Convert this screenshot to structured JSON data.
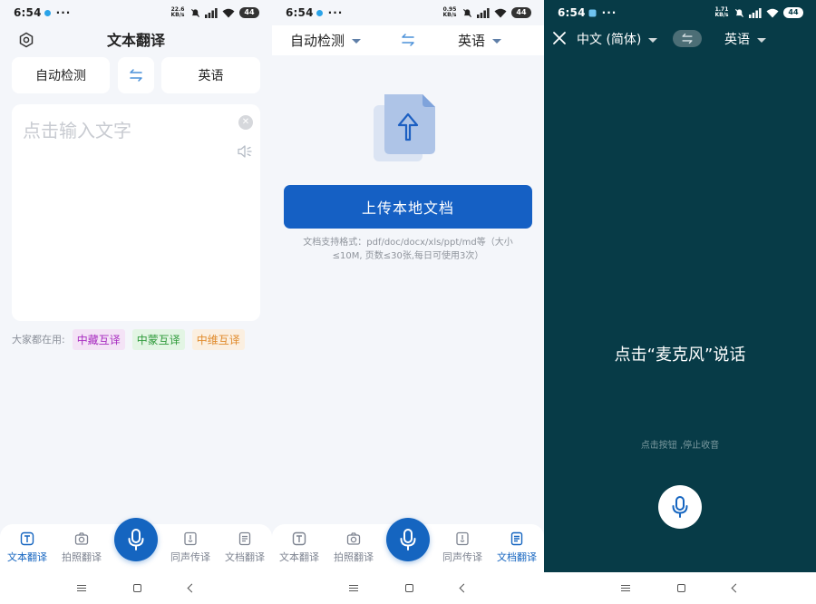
{
  "status_bars": [
    {
      "time": "6:54",
      "more": "···",
      "speed": "22.6 KB/s",
      "battery": "44"
    },
    {
      "time": "6:54",
      "more": "···",
      "speed": "0.95 KB/s",
      "battery": "44"
    },
    {
      "time": "6:54",
      "more": "···",
      "speed": "1.71 KB/s",
      "battery": "44"
    }
  ],
  "screen1": {
    "title": "文本翻译",
    "source_lang": "自动检测",
    "target_lang": "英语",
    "input_placeholder": "点击输入文字",
    "popular_label": "大家都在用:",
    "chips": [
      "中藏互译",
      "中蒙互译",
      "中维互译"
    ]
  },
  "screen2": {
    "source_lang": "自动检测",
    "target_lang": "英语",
    "upload_button": "上传本地文档",
    "upload_note": "文档支持格式：pdf/doc/docx/xls/ppt/md等（大小≤10M, 页数≤30张,每日可使用3次）"
  },
  "screen3": {
    "source_lang": "中文 (简体)",
    "target_lang": "英语",
    "prompt": "点击“麦克风”说话",
    "hint": "点击按钮 ,停止收音"
  },
  "bottom_nav": {
    "items": [
      "文本翻译",
      "拍照翻译",
      "同声传译",
      "文档翻译"
    ]
  },
  "colors": {
    "accent": "#1565c0",
    "voice_bg": "#073b47",
    "page_bg": "#f4f6fa"
  }
}
